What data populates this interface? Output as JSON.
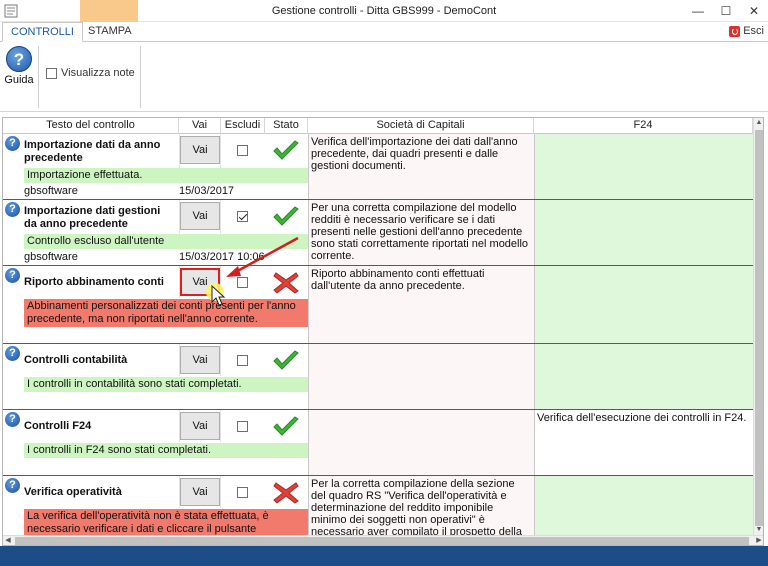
{
  "window": {
    "title": "Gestione controlli - Ditta GBS999 - DemoCont",
    "controls": [
      "—",
      "☐",
      "✕"
    ]
  },
  "ribbon": {
    "tabs": [
      {
        "label": "CONTROLLI",
        "active": true
      },
      {
        "label": "STAMPA",
        "active": false
      }
    ],
    "esci_label": "Esci",
    "guida_label": "Guida",
    "visualizza_note_label": "Visualizza note"
  },
  "grid": {
    "headers": [
      "Testo del controllo",
      "Vai",
      "Escludi",
      "Stato",
      "Società di Capitali",
      "F24"
    ],
    "rows": [
      {
        "title": "Importazione dati da anno precedente",
        "vai_label": "Vai",
        "excluded": false,
        "status": "ok",
        "message": "Importazione effettuata.",
        "message_color": "green",
        "user": "gbsoftware",
        "date": "15/03/2017",
        "societa_text": "Verifica dell'importazione dei dati dall'anno precedente, dai quadri presenti e dalle gestioni documenti.",
        "f24_text": ""
      },
      {
        "title": "Importazione dati gestioni da anno precedente",
        "vai_label": "Vai",
        "excluded": true,
        "status": "ok",
        "message": "Controllo escluso dall'utente",
        "message_color": "green",
        "user": "gbsoftware",
        "date": "15/03/2017 10:06",
        "societa_text": "Per una corretta compilazione del modello redditi è necessario verificare se i dati presenti nelle gestioni dell'anno precedente sono stati correttamente riportati nel modello corrente.",
        "f24_text": ""
      },
      {
        "title": "Riporto abbinamento conti",
        "vai_label": "Vai",
        "excluded": false,
        "status": "error",
        "message": "Abbinamenti personalizzati dei conti presenti per l'anno precedente, ma non riportati nell'anno corrente.",
        "message_color": "red",
        "user": "",
        "date": "",
        "societa_text": "Riporto abbinamento conti effettuati dall'utente da anno precedente.",
        "f24_text": ""
      },
      {
        "title": "Controlli contabilità",
        "vai_label": "Vai",
        "excluded": false,
        "status": "ok",
        "message": "I controlli in contabilità sono stati completati.",
        "message_color": "green",
        "user": "",
        "date": "",
        "societa_text": "",
        "f24_text": ""
      },
      {
        "title": "Controlli F24",
        "vai_label": "Vai",
        "excluded": false,
        "status": "ok",
        "message": "I controlli in F24 sono stati completati.",
        "message_color": "green",
        "user": "",
        "date": "",
        "societa_text": "",
        "f24_text": "Verifica dell'esecuzione dei controlli in F24."
      },
      {
        "title": "Verifica operatività",
        "vai_label": "Vai",
        "excluded": false,
        "status": "error",
        "message": "La verifica dell'operatività non è stata effettuata, è necessario verificare i dati e cliccare il pulsante",
        "message_color": "red",
        "user": "",
        "date": "",
        "societa_text": "Per la corretta compilazione della sezione del quadro RS \"Verifica dell'operatività e determinazione del reddito imponibile minimo dei soggetti non operativi\" è necessario aver compilato il prospetto della",
        "f24_text": ""
      }
    ]
  },
  "colors": {
    "ok_green": "#cdf5c1",
    "error_red": "#f17a6c",
    "accent_blue": "#1c5aa6",
    "status_bar": "#1d4d86",
    "highlight": "#e11d1d"
  }
}
